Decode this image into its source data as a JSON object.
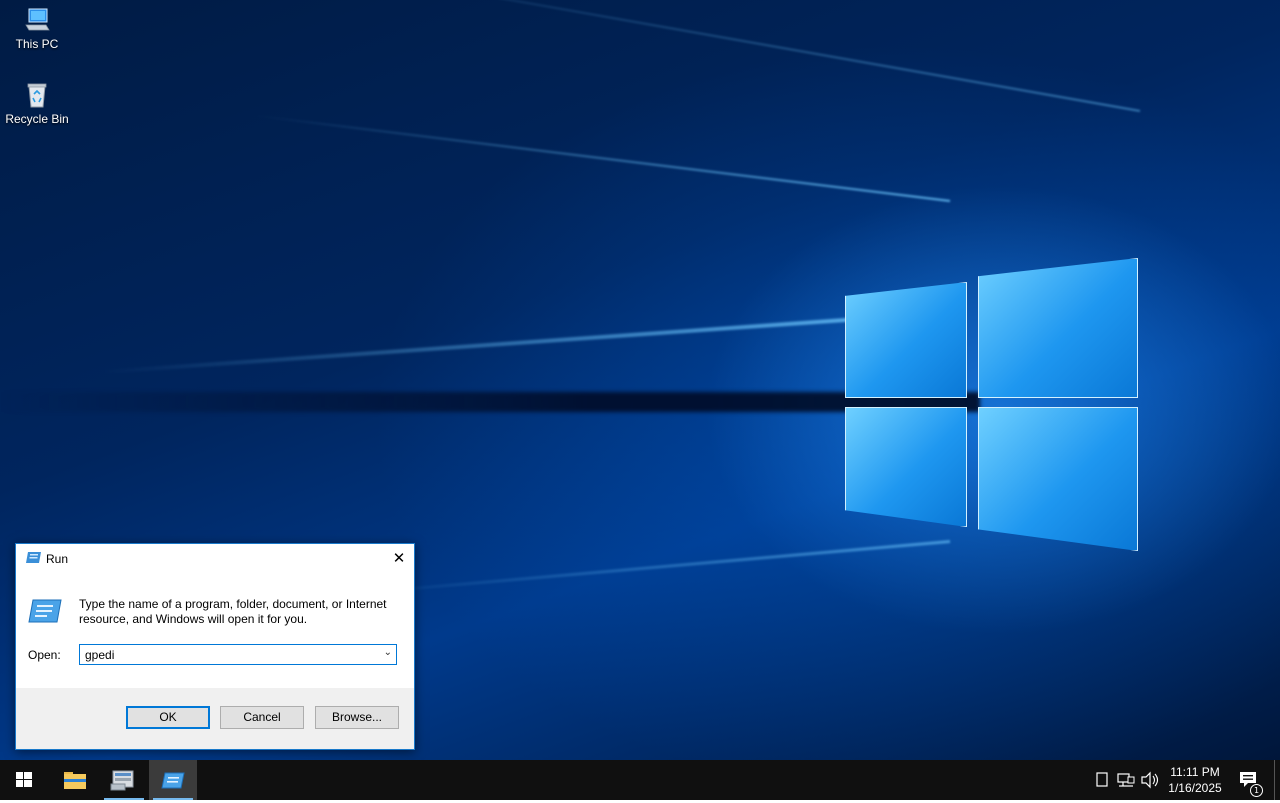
{
  "desktop": {
    "icons": [
      {
        "label": "This PC",
        "icon": "this-pc-icon"
      },
      {
        "label": "Recycle Bin",
        "icon": "recycle-bin-icon"
      }
    ]
  },
  "run_dialog": {
    "title": "Run",
    "close_glyph": "✕",
    "description": "Type the name of a program, folder, document, or Internet resource, and Windows will open it for you.",
    "open_label": "Open:",
    "open_value": "gpedi",
    "dropdown_glyph": "⌄",
    "buttons": {
      "ok": "OK",
      "cancel": "Cancel",
      "browse": "Browse..."
    }
  },
  "taskbar": {
    "pinned": [
      {
        "name": "start-button",
        "icon": "windows-logo-icon"
      },
      {
        "name": "file-explorer",
        "icon": "folder-icon"
      },
      {
        "name": "server-manager",
        "icon": "server-manager-icon"
      },
      {
        "name": "run-window",
        "icon": "run-icon"
      }
    ],
    "tray": {
      "icons": [
        "action-center-square-icon",
        "network-icon",
        "volume-icon"
      ],
      "time": "11:11 PM",
      "date": "1/16/2025",
      "notification_count": "1"
    }
  },
  "colors": {
    "accent": "#0078d7",
    "taskbar": "#101010",
    "wallpaper_dark": "#001b44",
    "wallpaper_glow": "#1e97f0"
  }
}
